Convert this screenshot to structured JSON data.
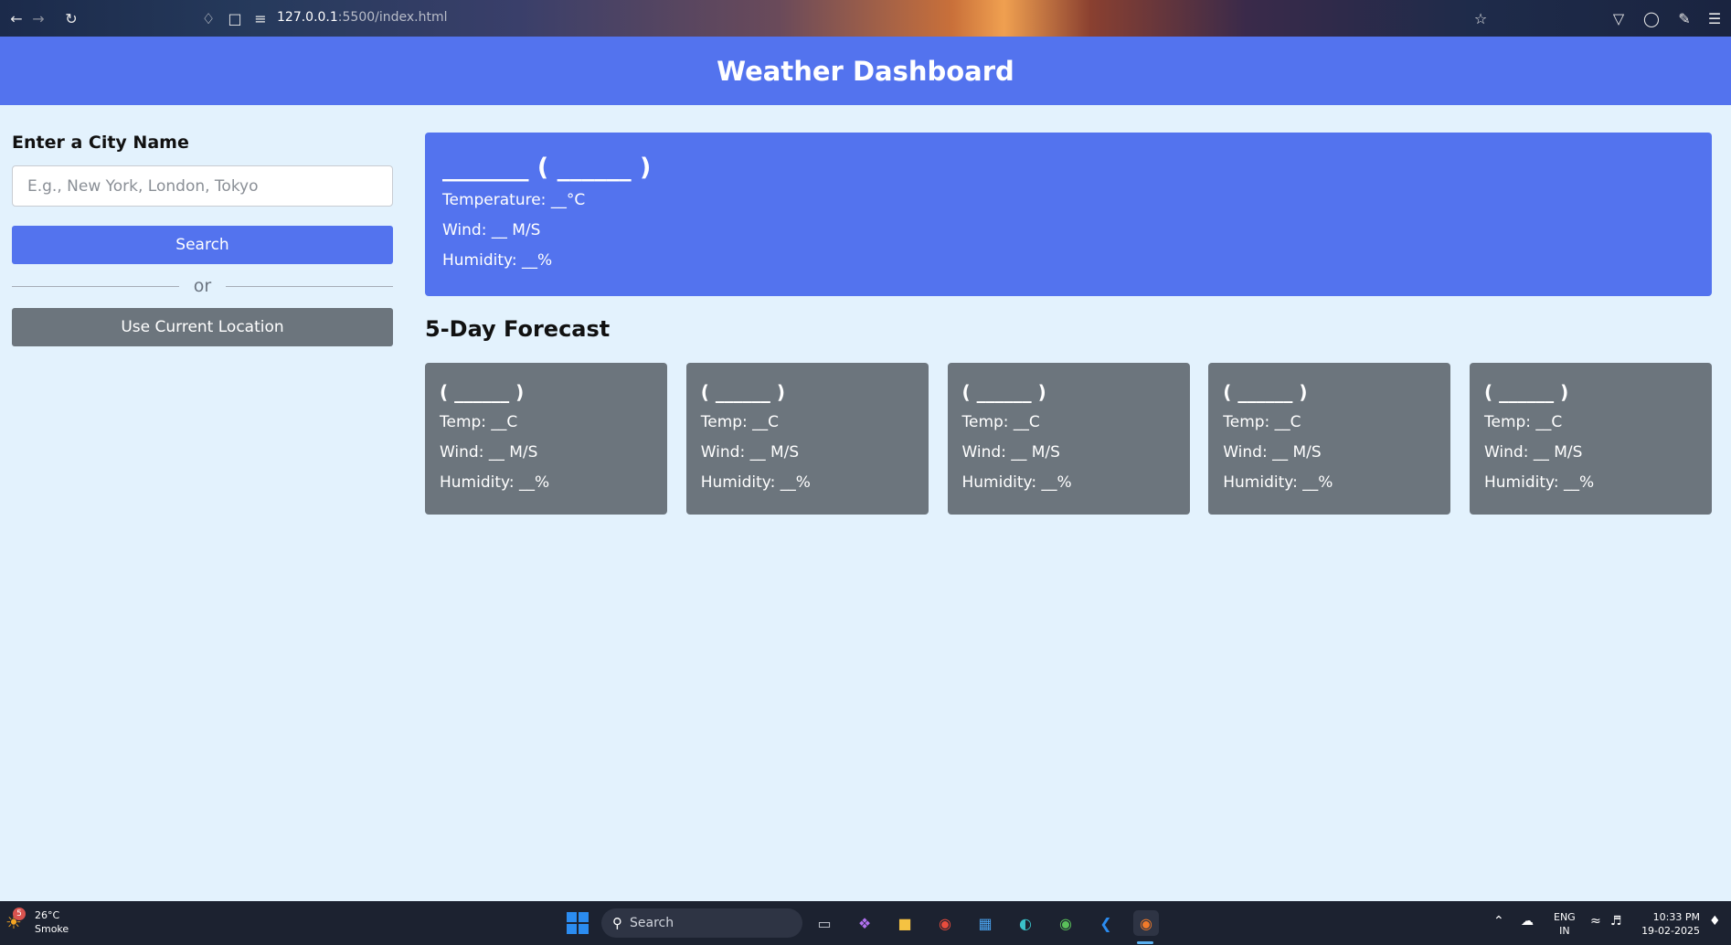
{
  "browser": {
    "url_host": "127.0.0.1",
    "url_path": ":5500/index.html"
  },
  "header": {
    "title": "Weather Dashboard"
  },
  "sidebar": {
    "heading": "Enter a City Name",
    "input_placeholder": "E.g., New York, London, Tokyo",
    "search_label": "Search",
    "divider_text": "or",
    "location_label": "Use Current Location"
  },
  "current": {
    "title": "_______ ( ______ )",
    "temperature": "Temperature: __°C",
    "wind": "Wind: __ M/S",
    "humidity": "Humidity: __%"
  },
  "forecast": {
    "title": "5-Day Forecast",
    "days": [
      {
        "date": "( ______ )",
        "temp": "Temp: __C",
        "wind": "Wind: __ M/S",
        "humidity": "Humidity: __%"
      },
      {
        "date": "( ______ )",
        "temp": "Temp: __C",
        "wind": "Wind: __ M/S",
        "humidity": "Humidity: __%"
      },
      {
        "date": "( ______ )",
        "temp": "Temp: __C",
        "wind": "Wind: __ M/S",
        "humidity": "Humidity: __%"
      },
      {
        "date": "( ______ )",
        "temp": "Temp: __C",
        "wind": "Wind: __ M/S",
        "humidity": "Humidity: __%"
      },
      {
        "date": "( ______ )",
        "temp": "Temp: __C",
        "wind": "Wind: __ M/S",
        "humidity": "Humidity: __%"
      }
    ]
  },
  "taskbar": {
    "weather_badge": "5",
    "weather_temp": "26°C",
    "weather_desc": "Smoke",
    "search_label": "Search",
    "lang_line1": "ENG",
    "lang_line2": "IN",
    "time": "10:33 PM",
    "date": "19-02-2025"
  },
  "colors": {
    "primary": "#5373ee",
    "secondary": "#6c757d",
    "page_bg": "#e3f2fd"
  }
}
